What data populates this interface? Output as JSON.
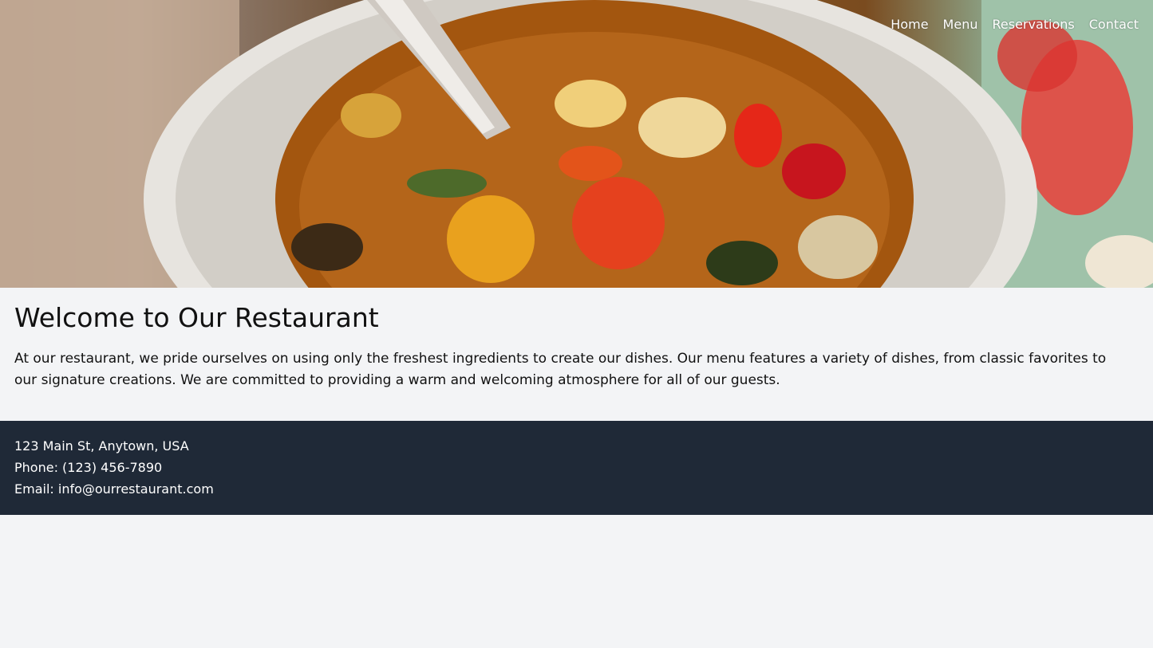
{
  "nav": {
    "items": [
      {
        "label": "Home"
      },
      {
        "label": "Menu"
      },
      {
        "label": "Reservations"
      },
      {
        "label": "Contact"
      }
    ]
  },
  "main": {
    "title": "Welcome to Our Restaurant",
    "intro": "At our restaurant, we pride ourselves on using only the freshest ingredients to create our dishes. Our menu features a variety of dishes, from classic favorites to our signature creations. We are committed to providing a warm and welcoming atmosphere for all of our guests."
  },
  "footer": {
    "address": "123 Main St, Anytown, USA",
    "phone": "Phone: (123) 456-7890",
    "email": "Email: info@ourrestaurant.com"
  },
  "colors": {
    "page_background": "#f3f4f6",
    "footer_background": "#1f2937",
    "footer_text": "#ffffff",
    "nav_text": "#ffffff"
  },
  "hero": {
    "image_subject": "bowl of vegetable soup"
  }
}
